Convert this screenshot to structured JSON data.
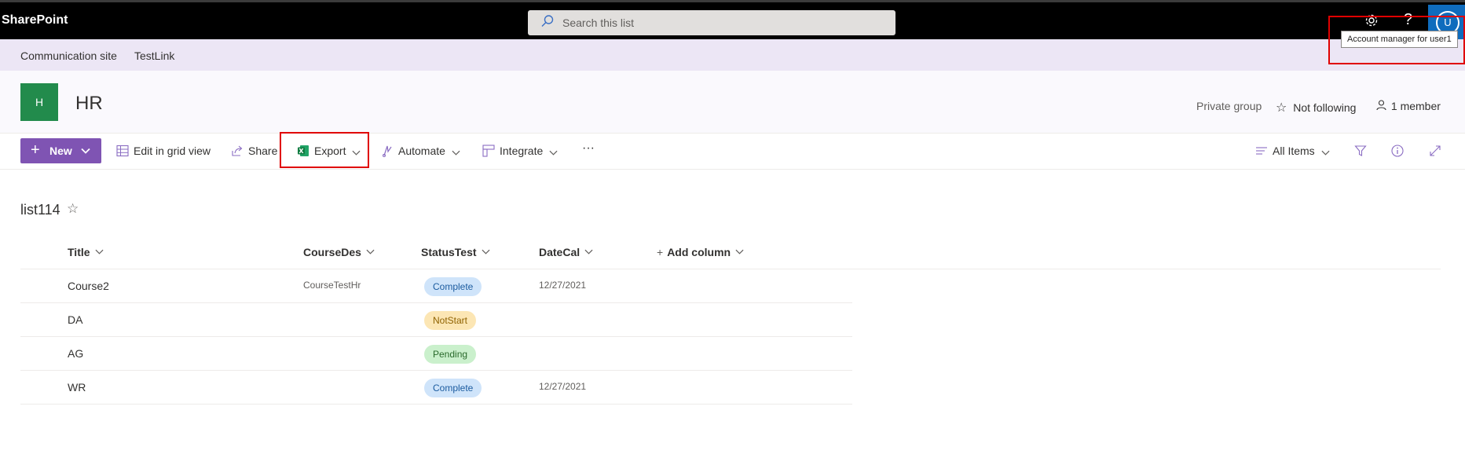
{
  "topbar": {
    "brand": "SharePoint",
    "search_placeholder": "Search this list",
    "avatar_initial": "U",
    "tooltip": "Account manager for user1"
  },
  "hub": {
    "links": [
      "Communication site",
      "TestLink"
    ]
  },
  "site": {
    "logo_letter": "H",
    "title": "HR",
    "privacy": "Private group",
    "follow": "Not following",
    "members": "1 member"
  },
  "commands": {
    "new": "New",
    "edit_grid": "Edit in grid view",
    "share": "Share",
    "export": "Export",
    "automate": "Automate",
    "integrate": "Integrate",
    "more": "···",
    "view": "All Items"
  },
  "list": {
    "title": "list114",
    "columns": [
      "Title",
      "CourseDes",
      "StatusTest",
      "DateCal",
      "Add column"
    ],
    "rows": [
      {
        "title": "Course2",
        "desc": "CourseTestHr",
        "status": "Complete",
        "date": "12/27/2021"
      },
      {
        "title": "DA",
        "desc": "",
        "status": "NotStart",
        "date": ""
      },
      {
        "title": "AG",
        "desc": "",
        "status": "Pending",
        "date": ""
      },
      {
        "title": "WR",
        "desc": "",
        "status": "Complete",
        "date": "12/27/2021"
      }
    ]
  },
  "colors": {
    "suite_bar": "#000000",
    "hub_bar": "#ece6f5",
    "accent": "#7f54b3",
    "site_logo": "#228b4c",
    "highlight": "#e00000"
  },
  "icons": [
    "search-icon",
    "gear-icon",
    "help-icon",
    "plus-icon",
    "chevron-down-icon",
    "grid-icon",
    "share-icon",
    "excel-icon",
    "automate-icon",
    "integrate-icon",
    "star-icon",
    "person-icon",
    "view-list-icon",
    "filter-icon",
    "info-icon",
    "expand-icon"
  ]
}
